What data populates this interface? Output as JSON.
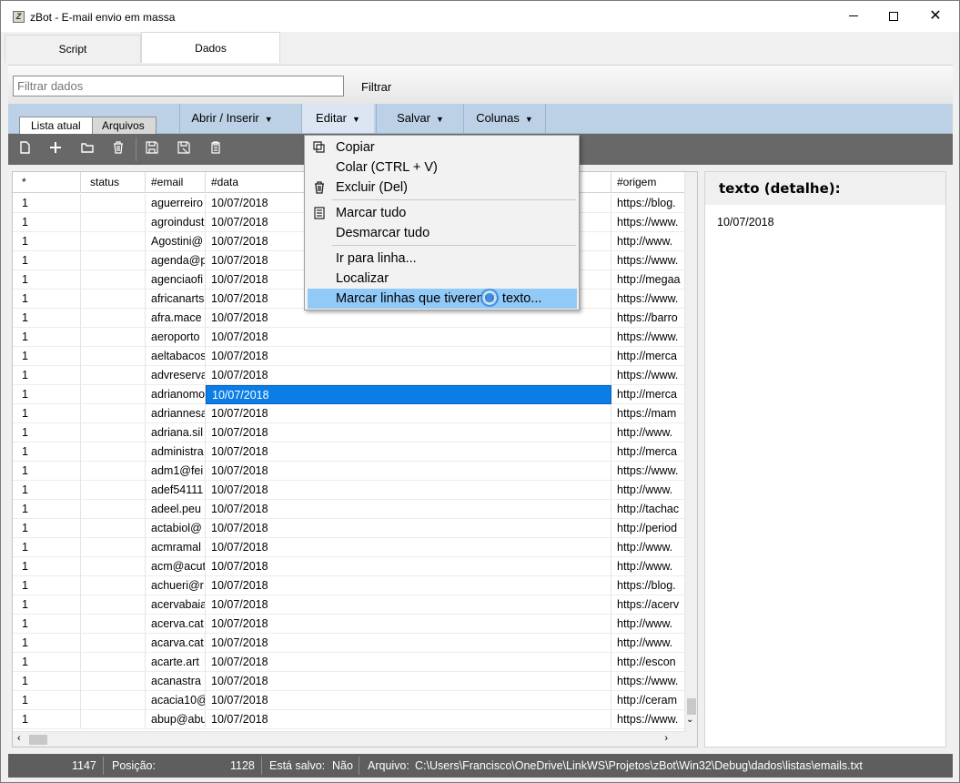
{
  "window": {
    "title": "zBot - E-mail envio em massa",
    "icon_letter": "Z"
  },
  "main_tabs": [
    {
      "label": "Script"
    },
    {
      "label": "Dados"
    }
  ],
  "filter": {
    "placeholder": "Filtrar dados",
    "button_label": "Filtrar"
  },
  "sub_tabs": [
    {
      "label": "Lista atual"
    },
    {
      "label": "Arquivos"
    }
  ],
  "menu": [
    {
      "label": "Abrir / Inserir"
    },
    {
      "label": "Editar"
    },
    {
      "label": "Salvar"
    },
    {
      "label": "Colunas"
    }
  ],
  "toolbar_icons": [
    "new-file-icon",
    "add-icon",
    "open-folder-icon",
    "delete-icon",
    "save-icon",
    "save-as-icon",
    "paste-icon"
  ],
  "grid": {
    "columns": [
      "*",
      "status",
      "#email",
      "#data",
      "#origem"
    ],
    "selected_row_index": 10,
    "rows": [
      {
        "star": "1",
        "status": "",
        "email": "aguerreiro",
        "data": "10/07/2018",
        "origem": "https://blog."
      },
      {
        "star": "1",
        "status": "",
        "email": "agroindust",
        "data": "10/07/2018",
        "origem": "https://www."
      },
      {
        "star": "1",
        "status": "",
        "email": "Agostini@",
        "data": "10/07/2018",
        "origem": "http://www."
      },
      {
        "star": "1",
        "status": "",
        "email": "agenda@p",
        "data": "10/07/2018",
        "origem": "https://www."
      },
      {
        "star": "1",
        "status": "",
        "email": "agenciaofi",
        "data": "10/07/2018",
        "origem": "http://megaa"
      },
      {
        "star": "1",
        "status": "",
        "email": "africanarts",
        "data": "10/07/2018",
        "origem": "https://www."
      },
      {
        "star": "1",
        "status": "",
        "email": "afra.mace",
        "data": "10/07/2018",
        "origem": "https://barro"
      },
      {
        "star": "1",
        "status": "",
        "email": "aeroporto",
        "data": "10/07/2018",
        "origem": "https://www."
      },
      {
        "star": "1",
        "status": "",
        "email": "aeltabacos",
        "data": "10/07/2018",
        "origem": "http://merca"
      },
      {
        "star": "1",
        "status": "",
        "email": "advreserva",
        "data": "10/07/2018",
        "origem": "https://www."
      },
      {
        "star": "1",
        "status": "",
        "email": "adrianomo",
        "data": "10/07/2018",
        "origem": "http://merca"
      },
      {
        "star": "1",
        "status": "",
        "email": "adriannesa",
        "data": "10/07/2018",
        "origem": "https://mam"
      },
      {
        "star": "1",
        "status": "",
        "email": "adriana.sil",
        "data": "10/07/2018",
        "origem": "http://www."
      },
      {
        "star": "1",
        "status": "",
        "email": "administra",
        "data": "10/07/2018",
        "origem": "http://merca"
      },
      {
        "star": "1",
        "status": "",
        "email": "adm1@fei",
        "data": "10/07/2018",
        "origem": "https://www."
      },
      {
        "star": "1",
        "status": "",
        "email": "adef54111",
        "data": "10/07/2018",
        "origem": "http://www."
      },
      {
        "star": "1",
        "status": "",
        "email": "adeel.peu",
        "data": "10/07/2018",
        "origem": "http://tachac"
      },
      {
        "star": "1",
        "status": "",
        "email": "actabiol@",
        "data": "10/07/2018",
        "origem": "http://period"
      },
      {
        "star": "1",
        "status": "",
        "email": "acmramal",
        "data": "10/07/2018",
        "origem": "http://www."
      },
      {
        "star": "1",
        "status": "",
        "email": "acm@acut",
        "data": "10/07/2018",
        "origem": "http://www."
      },
      {
        "star": "1",
        "status": "",
        "email": "achueri@r",
        "data": "10/07/2018",
        "origem": "https://blog."
      },
      {
        "star": "1",
        "status": "",
        "email": "acervabaia",
        "data": "10/07/2018",
        "origem": "https://acerv"
      },
      {
        "star": "1",
        "status": "",
        "email": "acerva.cat",
        "data": "10/07/2018",
        "origem": "http://www."
      },
      {
        "star": "1",
        "status": "",
        "email": "acarva.cat",
        "data": "10/07/2018",
        "origem": "http://www."
      },
      {
        "star": "1",
        "status": "",
        "email": "acarte.art",
        "data": "10/07/2018",
        "origem": "http://escon"
      },
      {
        "star": "1",
        "status": "",
        "email": "acanastra",
        "data": "10/07/2018",
        "origem": "https://www."
      },
      {
        "star": "1",
        "status": "",
        "email": "acacia10@",
        "data": "10/07/2018",
        "origem": "http://ceram"
      },
      {
        "star": "1",
        "status": "",
        "email": "abup@abu",
        "data": "10/07/2018",
        "origem": "https://www."
      }
    ]
  },
  "detail": {
    "title": "texto (detalhe):",
    "value": "10/07/2018"
  },
  "edit_menu": {
    "items": [
      {
        "label": "Copiar",
        "icon": "copy-icon"
      },
      {
        "label": "Colar (CTRL + V)",
        "icon": ""
      },
      {
        "label": "Excluir (Del)",
        "icon": "trash-icon"
      },
      {
        "label": "Marcar tudo",
        "icon": "select-all-icon"
      },
      {
        "label": "Desmarcar tudo",
        "icon": ""
      },
      {
        "label": "Ir para linha...",
        "icon": ""
      },
      {
        "label": "Localizar",
        "icon": ""
      },
      {
        "label": "Marcar linhas que tiverem o texto...",
        "icon": "",
        "highlighted": true
      }
    ]
  },
  "status": {
    "count": "1147",
    "position_label": "Posição:",
    "position_value": "1128",
    "saved_label": "Está salvo:",
    "saved_value": "Não",
    "file_label": "Arquivo:",
    "file_path": "C:\\Users\\Francisco\\OneDrive\\LinkWS\\Projetos\\zBot\\Win32\\Debug\\dados\\listas\\emails.txt"
  },
  "colors": {
    "menubar": "#bcd1e6",
    "toolbar": "#686868",
    "selection": "#0a7ee6",
    "menu_highlight": "#91c9f7",
    "statusbar": "#5e5e5e"
  }
}
